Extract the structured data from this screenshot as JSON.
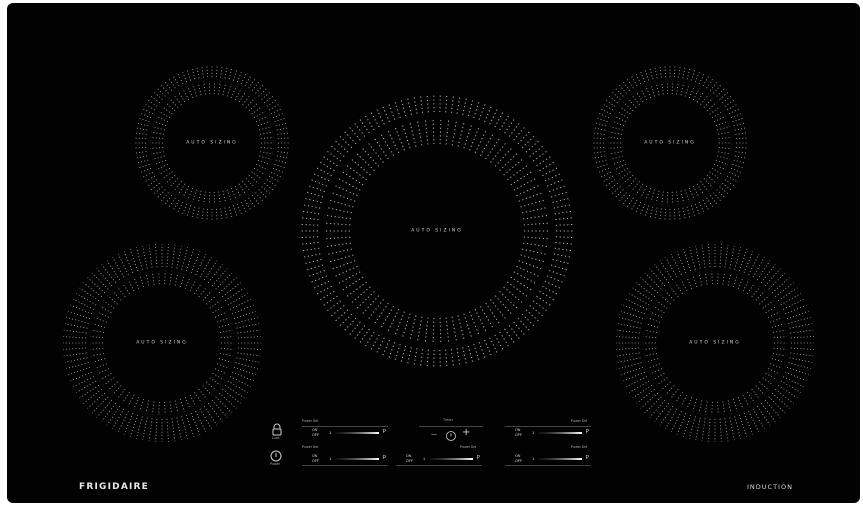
{
  "brand": "FRIGIDAIRE",
  "product_line": "INDUCTION",
  "zones": [
    {
      "id": "rear-left",
      "label": "AUTO SIZING"
    },
    {
      "id": "center",
      "label": "AUTO SIZING"
    },
    {
      "id": "rear-right",
      "label": "AUTO SIZING"
    },
    {
      "id": "front-left",
      "label": "AUTO SIZING"
    },
    {
      "id": "front-right",
      "label": "AUTO SIZING"
    }
  ],
  "controls": {
    "lock_label": "Lock",
    "power_label": "Power",
    "timer_label": "Timer",
    "timer_minus": "—",
    "timer_plus": "+",
    "zone_controls": [
      {
        "name": "Power Set",
        "on": "ON",
        "off": "OFF",
        "min": "1",
        "max": "P"
      },
      {
        "name": "Power Set",
        "on": "ON",
        "off": "OFF",
        "min": "1",
        "max": "P"
      },
      {
        "name": "Power Set",
        "on": "ON",
        "off": "OFF",
        "min": "1",
        "max": "P"
      },
      {
        "name": "Power Set",
        "on": "ON",
        "off": "OFF",
        "min": "1",
        "max": "P"
      },
      {
        "name": "Power Set",
        "on": "ON",
        "off": "OFF",
        "min": "1",
        "max": "P"
      }
    ]
  },
  "colors": {
    "surface": "#020202",
    "dots": "#cfcfcf",
    "text": "#d8d8d8"
  }
}
